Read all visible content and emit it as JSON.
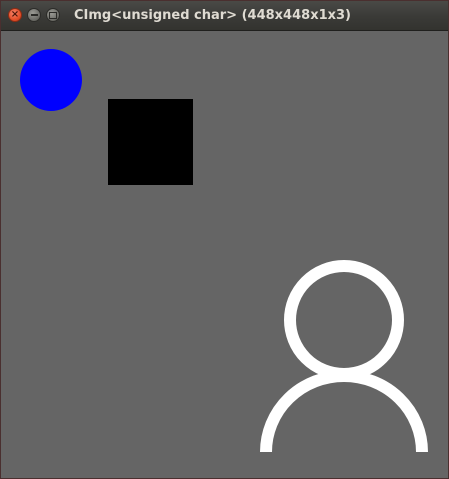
{
  "window": {
    "title": "CImg<unsigned char> (448x448x1x3)",
    "close_glyph": "×",
    "min_glyph_name": "minimize-icon",
    "max_glyph_name": "maximize-icon"
  },
  "canvas": {
    "background": "#656565",
    "shapes": {
      "circle_color": "#0000ff",
      "square_color": "#000000",
      "person_icon": "person-icon",
      "person_color": "#ffffff"
    }
  }
}
